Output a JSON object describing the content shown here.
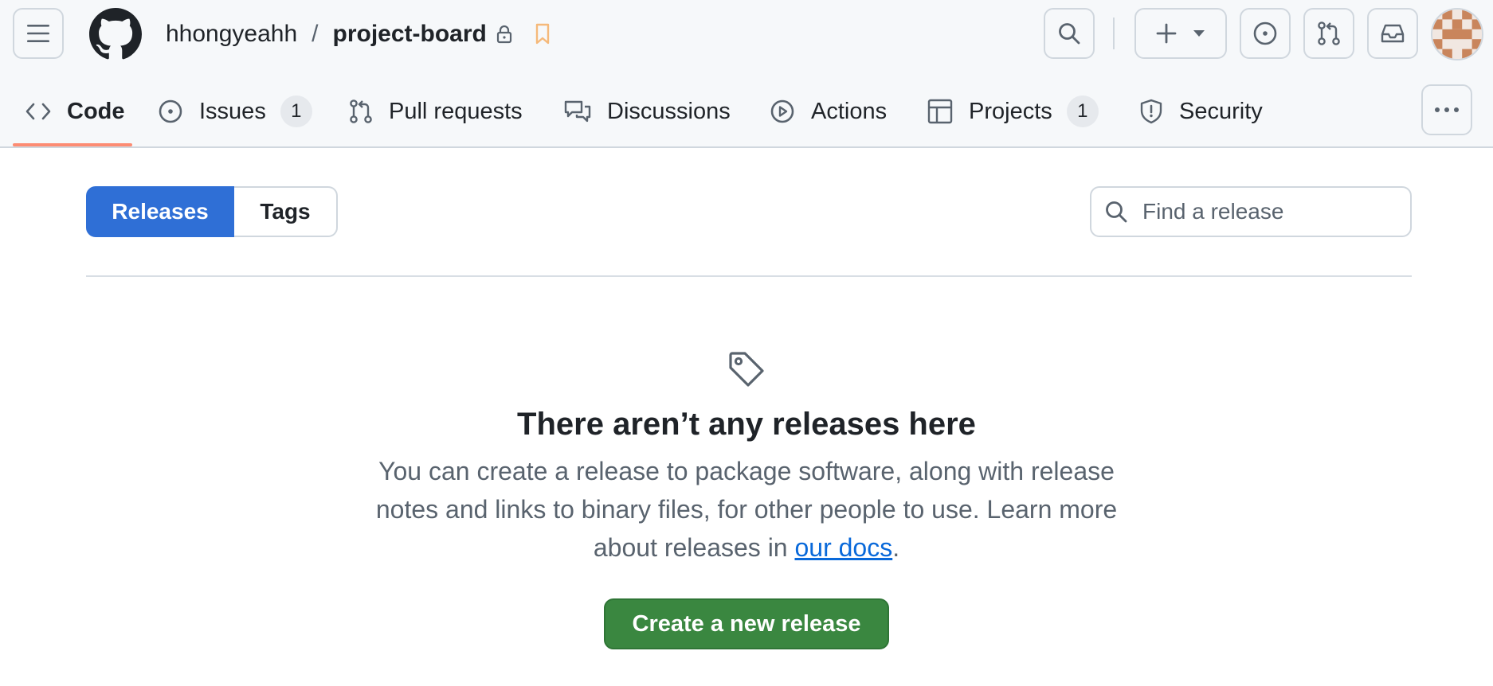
{
  "header": {
    "owner": "hhongyeahh",
    "separator": "/",
    "repo": "project-board"
  },
  "nav": {
    "code": "Code",
    "issues": "Issues",
    "issues_count": "1",
    "pulls": "Pull requests",
    "discussions": "Discussions",
    "actions": "Actions",
    "projects": "Projects",
    "projects_count": "1",
    "security": "Security"
  },
  "subnav": {
    "releases": "Releases",
    "tags": "Tags"
  },
  "search": {
    "placeholder": "Find a release"
  },
  "blankslate": {
    "title": "There aren’t any releases here",
    "text_before": "You can create a release to package software, along with release notes and links to binary files, for other people to use. Learn more about releases in ",
    "link": "our docs",
    "text_after": ".",
    "button": "Create a new release"
  },
  "colors": {
    "accent_blue": "#2f6fd6",
    "create_green": "#3a8740",
    "tab_underline": "#fd8c73"
  }
}
